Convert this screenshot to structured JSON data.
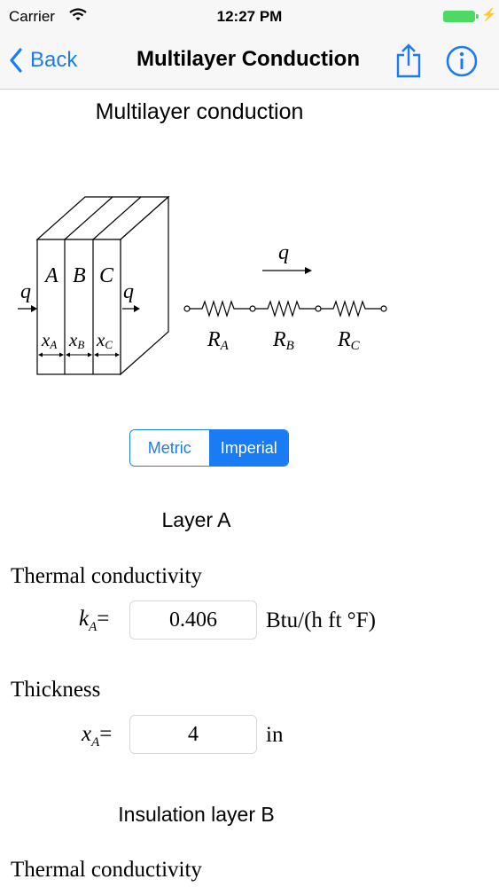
{
  "status_bar": {
    "carrier": "Carrier",
    "time": "12:27 PM"
  },
  "nav": {
    "back_label": "Back",
    "title": "Multilayer Conduction"
  },
  "page_heading": "Multilayer conduction",
  "diagram": {
    "layers": [
      "A",
      "B",
      "C"
    ],
    "heat_flow": "q",
    "thicknesses": [
      "x",
      "x",
      "x"
    ],
    "thickness_subs": [
      "A",
      "B",
      "C"
    ],
    "resistances": [
      "R",
      "R",
      "R"
    ],
    "resistance_subs": [
      "A",
      "B",
      "C"
    ]
  },
  "unit_toggle": {
    "metric_label": "Metric",
    "imperial_label": "Imperial",
    "selected": "Imperial"
  },
  "layer_a": {
    "title": "Layer A",
    "conductivity": {
      "label": "Thermal conductivity",
      "symbol": "k",
      "subscript": "A",
      "equals": "=",
      "value": "0.406",
      "unit": "Btu/(h ft °F)"
    },
    "thickness": {
      "label": "Thickness",
      "symbol": "x",
      "subscript": "A",
      "equals": "=",
      "value": "4",
      "unit": "in"
    }
  },
  "layer_b": {
    "title": "Insulation layer B",
    "conductivity": {
      "label": "Thermal conductivity"
    }
  },
  "colors": {
    "accent": "#1a7cf5",
    "battery": "#4cd964",
    "bar_bg": "#f7f7f7"
  }
}
